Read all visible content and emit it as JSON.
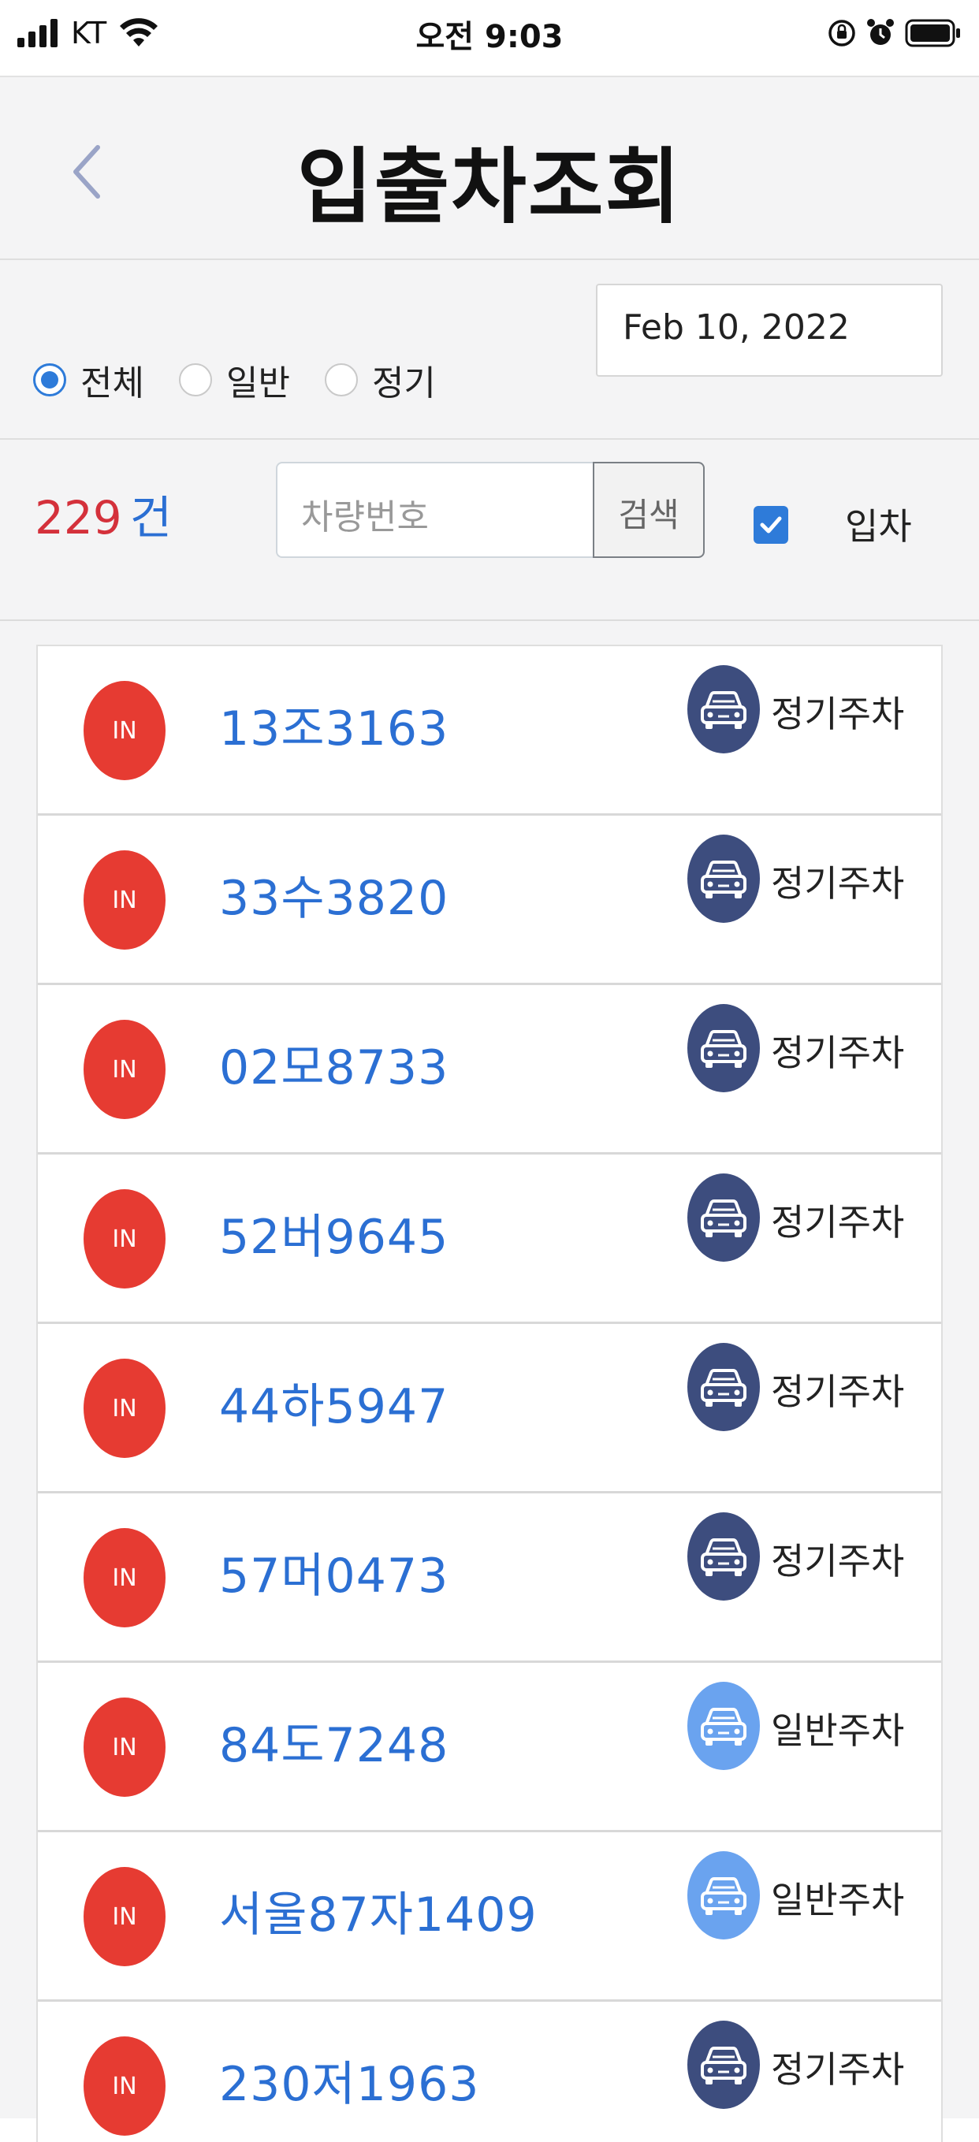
{
  "status": {
    "carrier": "KT",
    "time": "오전 9:03"
  },
  "header": {
    "title": "입출차조회"
  },
  "filter": {
    "options": [
      {
        "label": "전체",
        "checked": true
      },
      {
        "label": "일반",
        "checked": false
      },
      {
        "label": "정기",
        "checked": false
      }
    ],
    "date": "Feb 10, 2022"
  },
  "search": {
    "count": "229",
    "count_unit": "건",
    "placeholder": "차량번호",
    "button_label": "검색",
    "checkbox_label": "입차",
    "checkbox_checked": true
  },
  "list": {
    "badge_label": "IN",
    "rows": [
      {
        "plate": "13조3163",
        "type": "정기주차",
        "kind": "regular"
      },
      {
        "plate": "33수3820",
        "type": "정기주차",
        "kind": "regular"
      },
      {
        "plate": "02모8733",
        "type": "정기주차",
        "kind": "regular"
      },
      {
        "plate": "52버9645",
        "type": "정기주차",
        "kind": "regular"
      },
      {
        "plate": "44하5947",
        "type": "정기주차",
        "kind": "regular"
      },
      {
        "plate": "57머0473",
        "type": "정기주차",
        "kind": "regular"
      },
      {
        "plate": "84도7248",
        "type": "일반주차",
        "kind": "general"
      },
      {
        "plate": "서울87자1409",
        "type": "일반주차",
        "kind": "general"
      },
      {
        "plate": "230저1963",
        "type": "정기주차",
        "kind": "regular"
      }
    ]
  },
  "colors": {
    "accent_blue": "#2b6fd3",
    "count_red": "#d4313b",
    "badge_red": "#e63b32",
    "regular_icon": "#3d4d7e",
    "general_icon": "#6aa3ef"
  }
}
